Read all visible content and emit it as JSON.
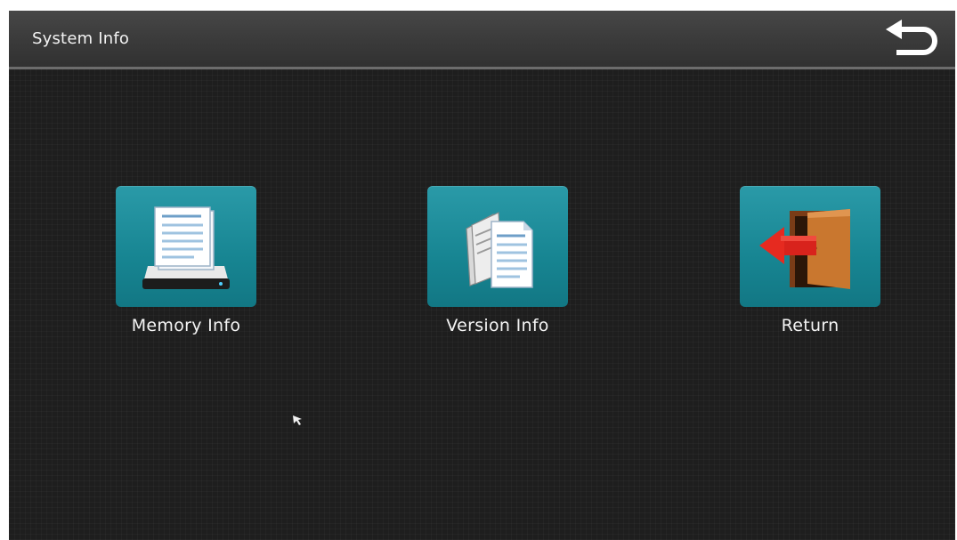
{
  "header": {
    "title": "System Info",
    "back_icon": "undo-arrow-icon"
  },
  "menu": {
    "items": [
      {
        "id": "memory",
        "label": "Memory Info",
        "icon": "hard-drive-document-icon"
      },
      {
        "id": "version",
        "label": "Version Info",
        "icon": "documents-stack-icon"
      },
      {
        "id": "return",
        "label": "Return",
        "icon": "exit-door-icon"
      }
    ]
  },
  "colors": {
    "screen_bg": "#1e1e1e",
    "titlebar": "#3a3a3a",
    "tile_teal": "#178592",
    "exit_arrow_red": "#d8231c",
    "door_brown": "#b8692c"
  }
}
